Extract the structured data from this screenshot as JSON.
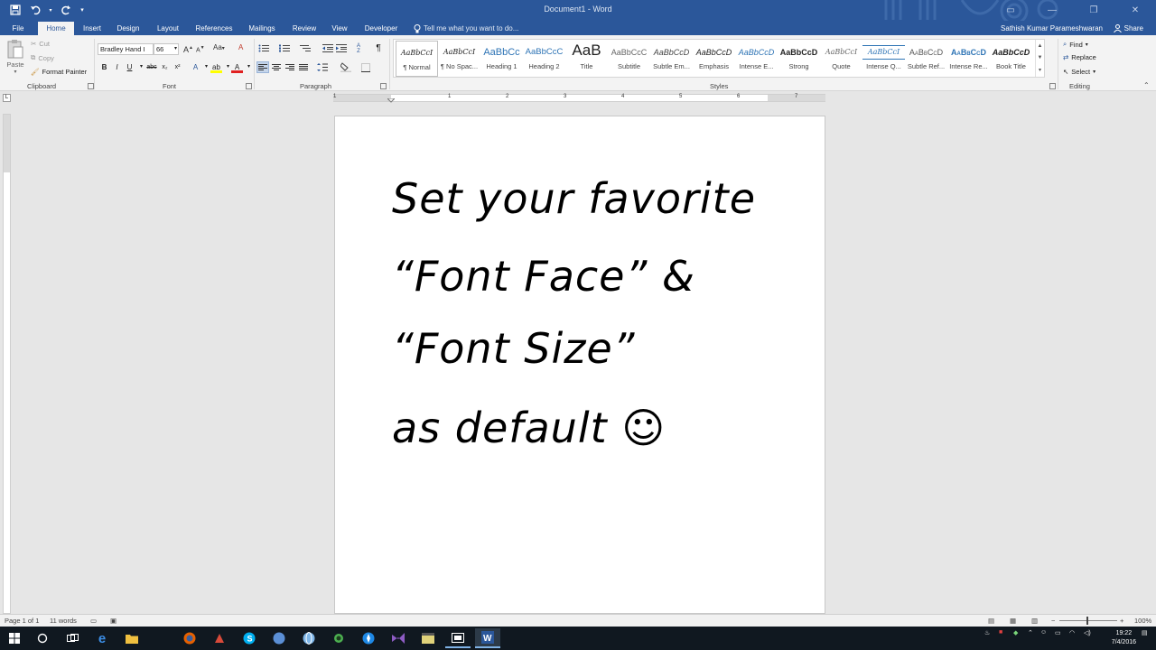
{
  "window": {
    "title": "Document1 - Word",
    "minimize": "—",
    "restore": "❐",
    "close": "✕"
  },
  "tabs": [
    "File",
    "Home",
    "Insert",
    "Design",
    "Layout",
    "References",
    "Mailings",
    "Review",
    "View",
    "Developer"
  ],
  "active_tab": "Home",
  "tell_me": "Tell me what you want to do...",
  "user_name": "Sathish Kumar Parameshwaran",
  "share_label": "Share",
  "clipboard": {
    "paste": "Paste",
    "cut": "Cut",
    "copy": "Copy",
    "format_painter": "Format Painter",
    "group_label": "Clipboard"
  },
  "font": {
    "font_name": "Bradley Hand I",
    "font_size": "66",
    "group_label": "Font",
    "bold": "B",
    "italic": "I",
    "underline": "U",
    "strike": "abc",
    "subscript": "x₂",
    "superscript": "x²",
    "grow": "A",
    "shrink": "A",
    "change_case": "Aa",
    "clear": "A"
  },
  "paragraph": {
    "group_label": "Paragraph",
    "pilcrow": "¶"
  },
  "styles": {
    "group_label": "Styles",
    "items": [
      {
        "preview": "AaBbCcI",
        "name": "¶ Normal"
      },
      {
        "preview": "AaBbCcI",
        "name": "¶ No Spac..."
      },
      {
        "preview": "AaBbCc",
        "name": "Heading 1"
      },
      {
        "preview": "AaBbCcC",
        "name": "Heading 2"
      },
      {
        "preview": "AaB",
        "name": "Title"
      },
      {
        "preview": "AaBbCcC",
        "name": "Subtitle"
      },
      {
        "preview": "AaBbCcD",
        "name": "Subtle Em..."
      },
      {
        "preview": "AaBbCcD",
        "name": "Emphasis"
      },
      {
        "preview": "AaBbCcD",
        "name": "Intense E..."
      },
      {
        "preview": "AaBbCcD",
        "name": "Strong"
      },
      {
        "preview": "AaBbCcI",
        "name": "Quote"
      },
      {
        "preview": "AaBbCcI",
        "name": "Intense Q..."
      },
      {
        "preview": "AaBbCcD",
        "name": "Subtle Ref..."
      },
      {
        "preview": "AaBbCcD",
        "name": "Intense Re..."
      },
      {
        "preview": "AaBbCcD",
        "name": "Book Title"
      }
    ]
  },
  "editing": {
    "find": "Find",
    "replace": "Replace",
    "select": "Select",
    "group_label": "Editing"
  },
  "ruler_numbers": [
    "1",
    "1",
    "2",
    "3",
    "4",
    "5",
    "6",
    "7"
  ],
  "document": {
    "lines": [
      "Set your favorite",
      "“Font Face” &",
      "“Font Size”",
      "as default ☺"
    ]
  },
  "status": {
    "page": "Page 1 of 1",
    "words": "11 words",
    "zoom": "100%",
    "zoom_minus": "−",
    "zoom_plus": "+"
  },
  "taskbar": {
    "time": "19:22",
    "date": "7/4/2016"
  },
  "colors": {
    "word_blue": "#2b579a",
    "ribbon_bg": "#f3f3f3",
    "canvas_bg": "#e6e6e6",
    "taskbar_bg": "#101820"
  }
}
